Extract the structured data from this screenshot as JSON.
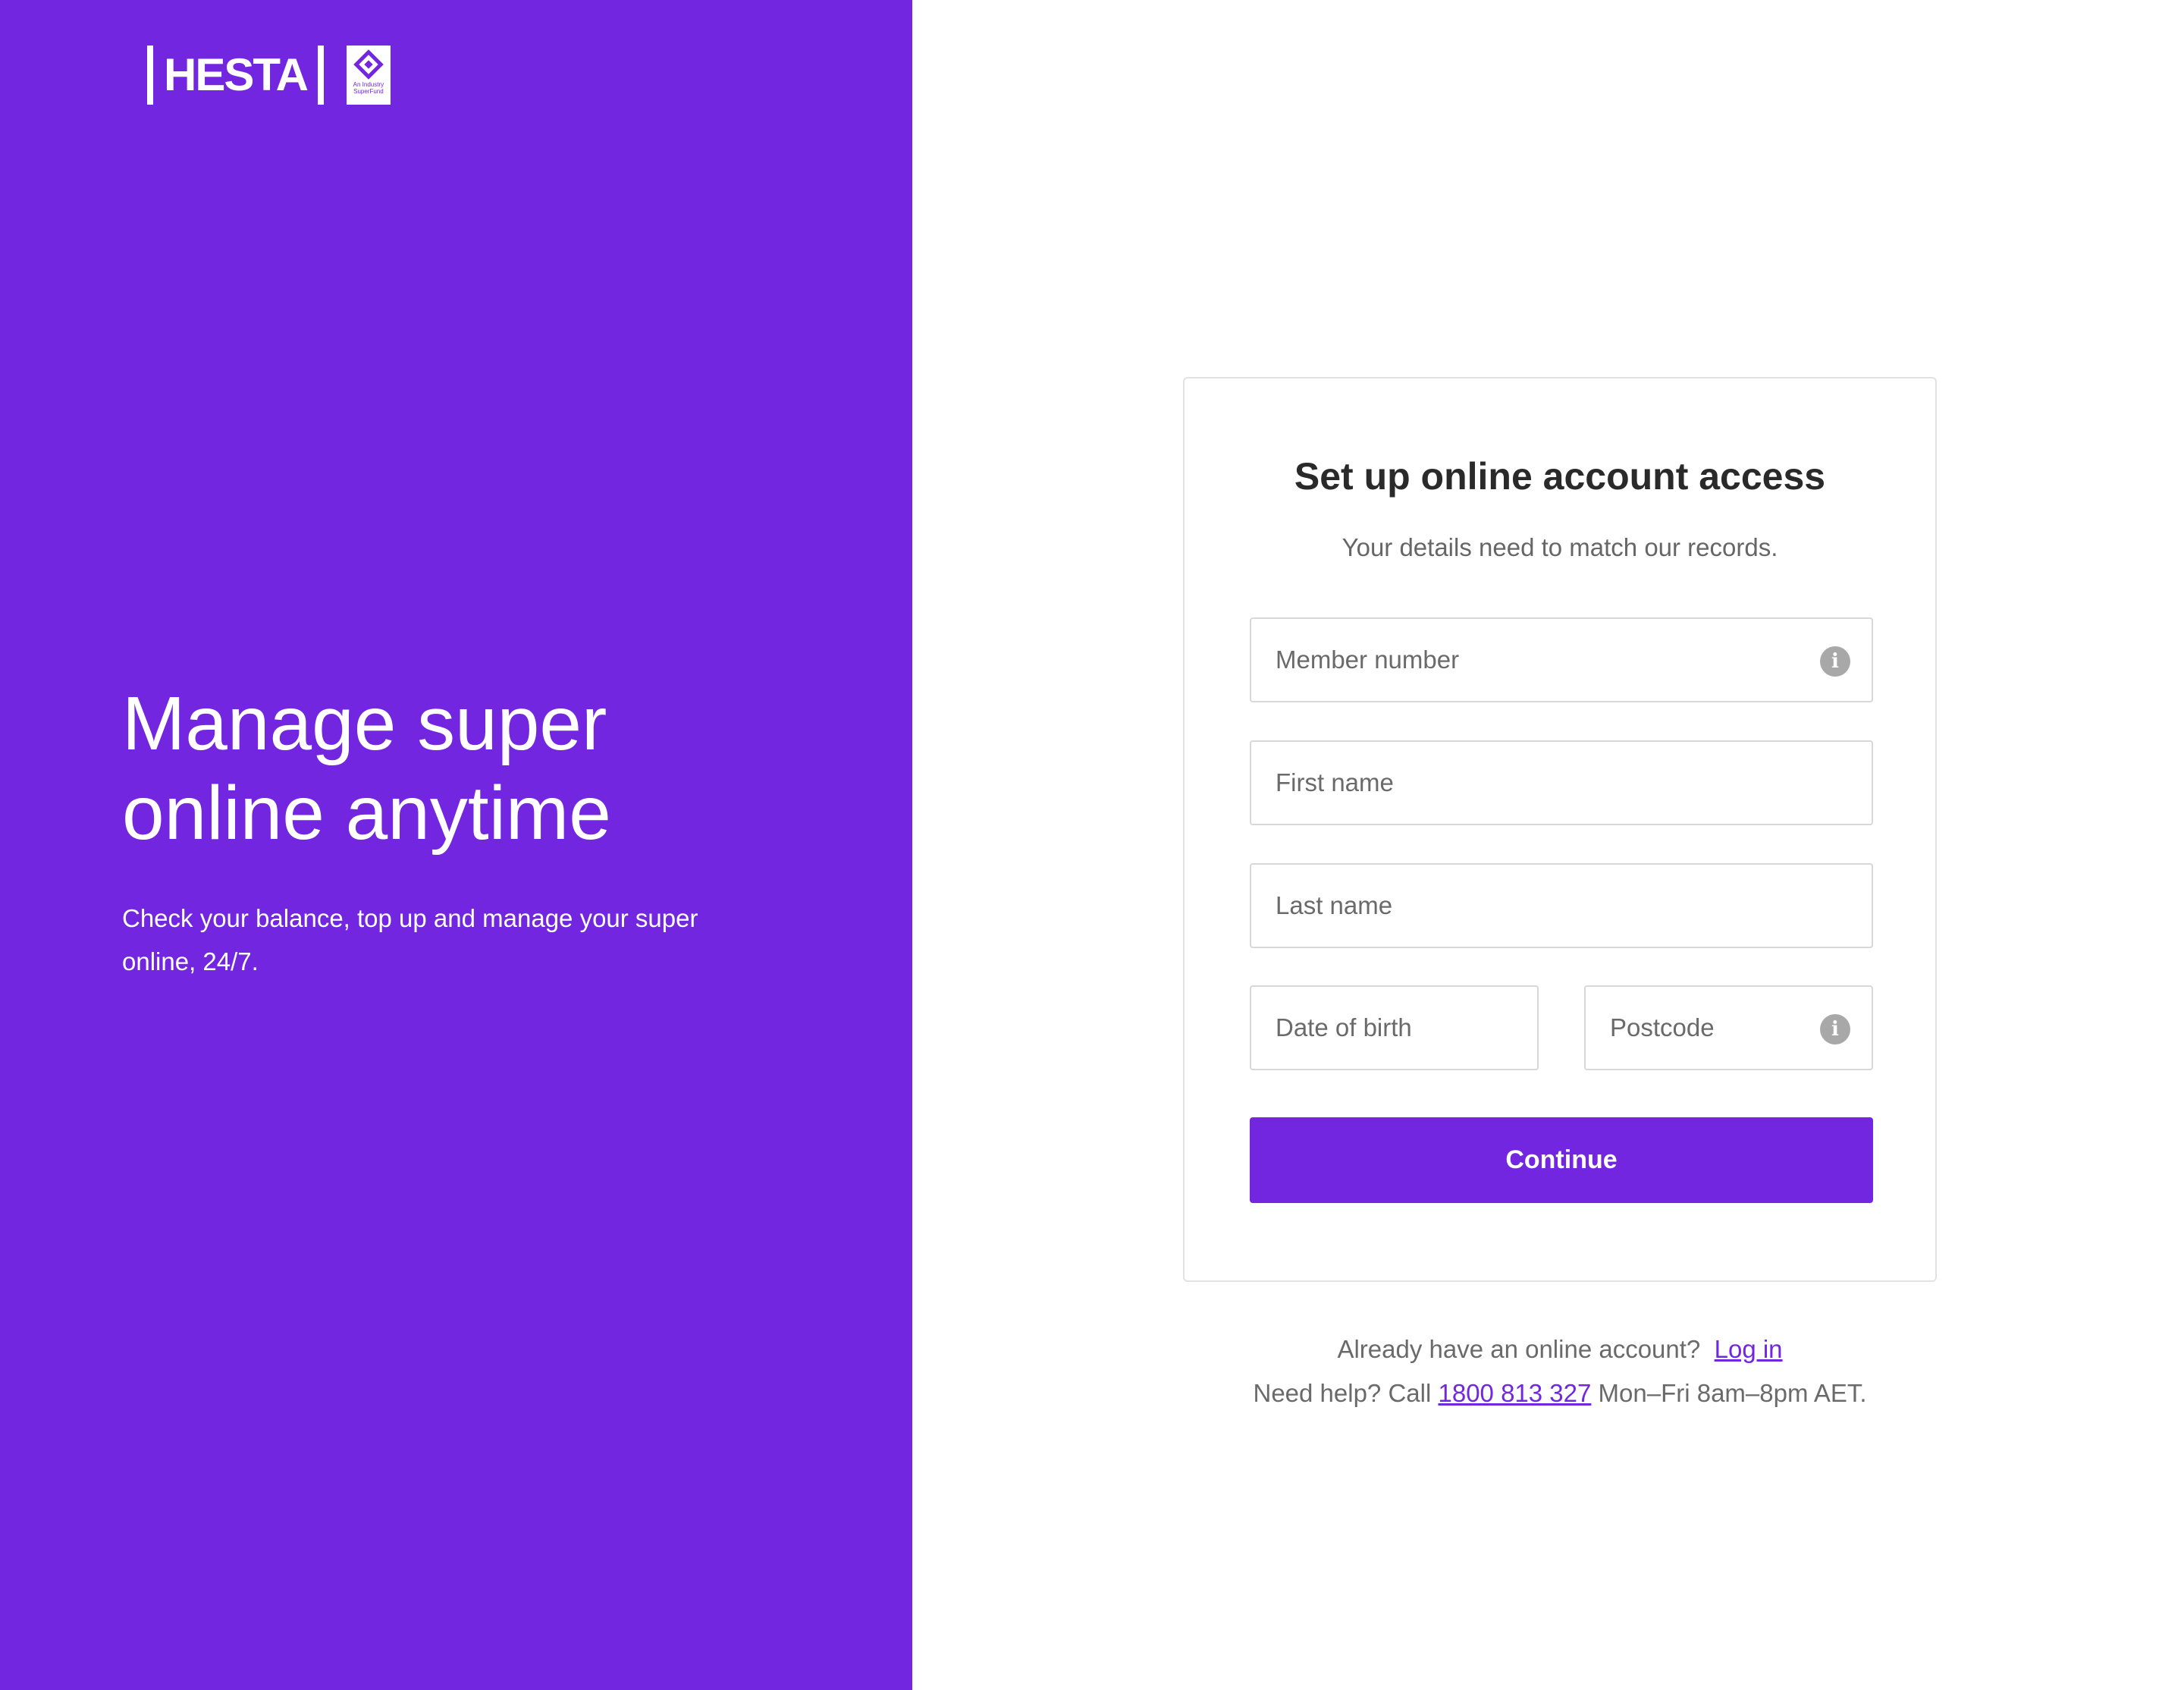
{
  "brand": {
    "name": "HESTA",
    "badge_text": "An Industry SuperFund",
    "color": "#7226e0"
  },
  "hero": {
    "headline_line1": "Manage super",
    "headline_line2": "online anytime",
    "subcopy": "Check your balance, top up and manage your super online, 24/7."
  },
  "form": {
    "title": "Set up online account access",
    "subtitle": "Your details need to match our records.",
    "member_number_placeholder": "Member number",
    "first_name_placeholder": "First name",
    "last_name_placeholder": "Last name",
    "dob_placeholder": "Date of birth",
    "postcode_placeholder": "Postcode",
    "info_icon_glyph": "i",
    "continue_label": "Continue"
  },
  "footer": {
    "login_prompt": "Already have an online account?",
    "login_link": "Log in",
    "help_prefix": "Need help? Call",
    "help_phone": "1800 813 327",
    "help_suffix": "Mon–Fri 8am–8pm AET."
  }
}
